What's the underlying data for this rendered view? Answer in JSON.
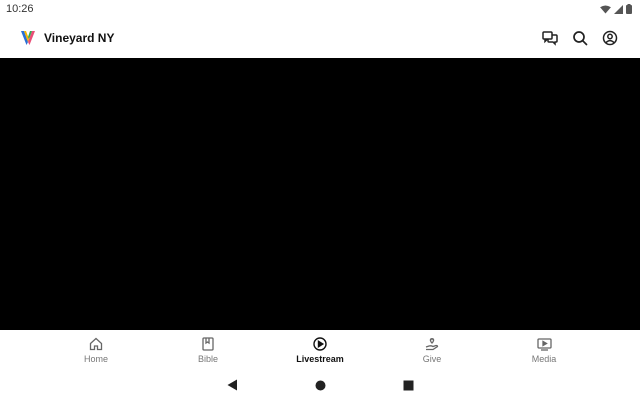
{
  "status_bar": {
    "time": "10:26"
  },
  "app_bar": {
    "title": "Vineyard NY",
    "actions": [
      "chat-icon",
      "search-icon",
      "account-icon"
    ]
  },
  "bottom_nav": {
    "active": "Livestream",
    "items": [
      {
        "label": "Home",
        "icon": "home-icon"
      },
      {
        "label": "Bible",
        "icon": "bible-icon"
      },
      {
        "label": "Livestream",
        "icon": "play-circle-icon"
      },
      {
        "label": "Give",
        "icon": "give-icon"
      },
      {
        "label": "Media",
        "icon": "media-icon"
      }
    ]
  },
  "colors": {
    "video_bg": "#000000",
    "active_text": "#111111",
    "inactive_text": "#777777"
  }
}
